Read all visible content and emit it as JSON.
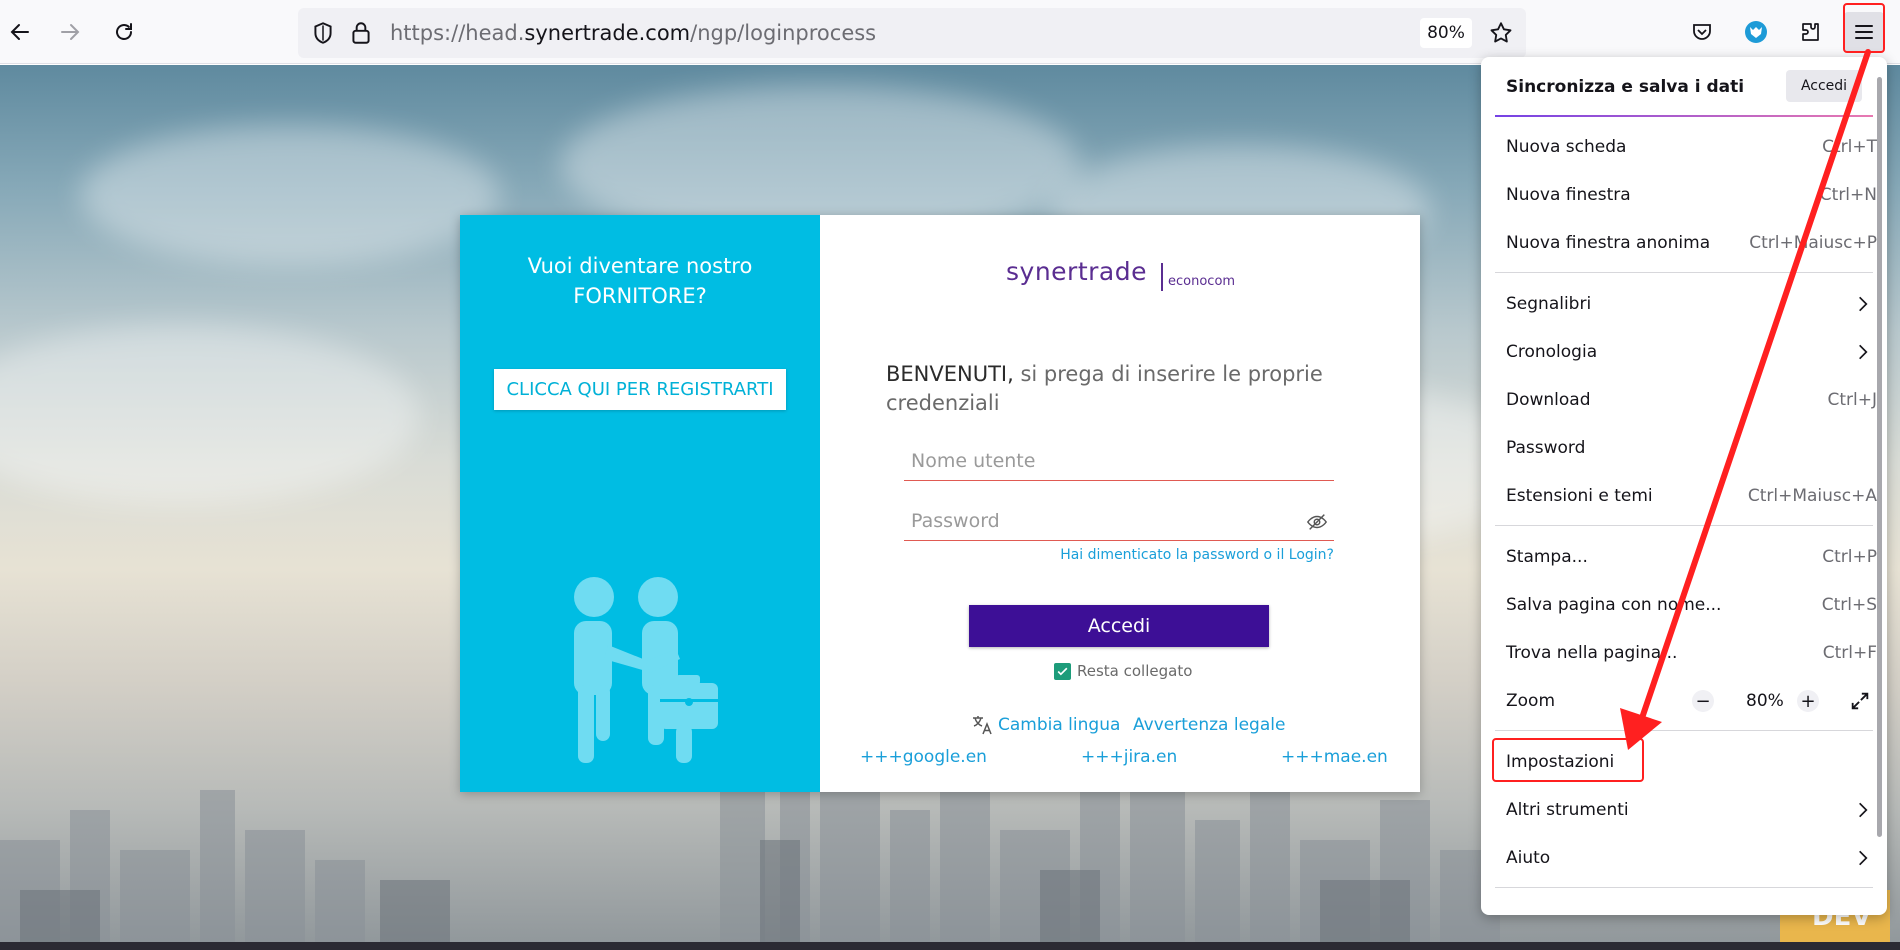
{
  "toolbar": {
    "url_prefix": "https://head.",
    "url_host": "synertrade.com",
    "url_path": "/ngp/loginprocess",
    "zoom": "80%",
    "icons": [
      "back-icon",
      "forward-icon",
      "reload-icon",
      "shield-icon",
      "lock-icon",
      "bookmark-star-icon",
      "pocket-icon",
      "extension-fox-icon",
      "extensions-icon",
      "hamburger-menu-icon"
    ]
  },
  "card": {
    "promo": "Vuoi diventare nostro FORNITORE?",
    "register_label": "CLICCA QUI PER REGISTRARTI",
    "logo_main": "synertrade",
    "logo_sub": "econocom",
    "welcome_strong": "BENVENUTI,",
    "welcome_rest": " si prega di inserire le proprie credenziali",
    "username_placeholder": "Nome utente",
    "password_placeholder": "Password",
    "forgot": "Hai dimenticato la password o il Login?",
    "login_label": "Accedi",
    "remember": "Resta collegato",
    "change_lang": "Cambia lingua",
    "legal": "Avvertenza legale",
    "ext_links": [
      "+++google.en",
      "+++jira.en",
      "+++mae.en"
    ],
    "colors": {
      "left_panel": "#00bde3",
      "button": "#3d0f96",
      "link": "#1a9fd9",
      "logo": "#5a2d91"
    }
  },
  "menu": {
    "sync_title": "Sincronizza e salva i dati",
    "sync_button": "Accedi",
    "items": [
      {
        "label": "Nuova scheda",
        "shortcut": "Ctrl+T"
      },
      {
        "label": "Nuova finestra",
        "shortcut": "Ctrl+N"
      },
      {
        "label": "Nuova finestra anonima",
        "shortcut": "Ctrl+Maiusc+P"
      },
      {
        "label": "Segnalibri",
        "shortcut": ""
      },
      {
        "label": "Cronologia",
        "shortcut": ""
      },
      {
        "label": "Download",
        "shortcut": "Ctrl+J"
      },
      {
        "label": "Password",
        "shortcut": ""
      },
      {
        "label": "Estensioni e temi",
        "shortcut": "Ctrl+Maiusc+A"
      },
      {
        "label": "Stampa...",
        "shortcut": "Ctrl+P"
      },
      {
        "label": "Salva pagina con nome...",
        "shortcut": "Ctrl+S"
      },
      {
        "label": "Trova nella pagina...",
        "shortcut": "Ctrl+F"
      },
      {
        "label": "Zoom",
        "shortcut": ""
      },
      {
        "label": "Impostazioni",
        "shortcut": ""
      },
      {
        "label": "Altri strumenti",
        "shortcut": ""
      },
      {
        "label": "Aiuto",
        "shortcut": ""
      }
    ],
    "zoom_value": "80%",
    "zoom_minus": "−",
    "zoom_plus": "+"
  },
  "page_badge": "DEV",
  "annotation_color": "#ff2020"
}
